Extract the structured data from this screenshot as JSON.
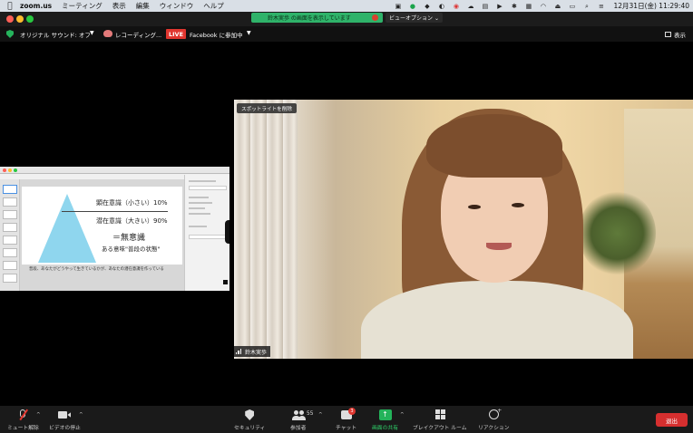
{
  "menubar": {
    "app_name": "zoom.us",
    "menus": [
      "ミーティング",
      "表示",
      "編集",
      "ウィンドウ",
      "ヘルプ"
    ],
    "clock": "12月31日(金)  11:29:40"
  },
  "titlebar": {
    "share_banner": "鈴木実歩 の画面を表示しています",
    "view_options": "ビューオプション ⌄"
  },
  "status": {
    "sound_label": "オリジナル サウンド: オフ",
    "recording_label": "レコーディング...",
    "live_badge": "LIVE",
    "live_text": "Facebook  に参加中",
    "display_label": "表示"
  },
  "shared_slide": {
    "line1": "顕在意識（小さい）10%",
    "line2": "潜在意識（大きい）90%",
    "line3": "＝無意識",
    "line4": "ある意味\"普段の状態\"",
    "caption": "普段、あなたがどうやって生きているかが、あなたの潜在意識を作っている"
  },
  "video": {
    "spotlight_label": "スポットライトを削除",
    "participant_name": "鈴木実歩"
  },
  "toolbar": {
    "mute_label": "ミュート解除",
    "video_label": "ビデオの停止",
    "security_label": "セキュリティ",
    "participants_label": "参加者",
    "participants_count": "55",
    "chat_label": "チャット",
    "chat_badge": "3",
    "share_label": "画面の共有",
    "breakout_label": "ブレイクアウト ルーム",
    "reaction_label": "リアクション",
    "leave_label": "退出"
  },
  "colors": {
    "live_red": "#e0362f",
    "share_green": "#23b35a",
    "leave_red": "#d62f2f"
  }
}
